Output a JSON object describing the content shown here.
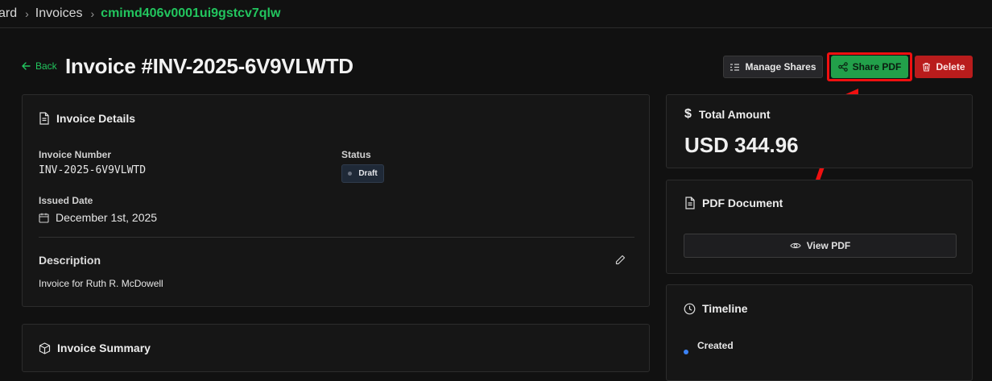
{
  "breadcrumb": {
    "items": [
      "ard",
      "Invoices"
    ],
    "current": "cmimd406v0001ui9gstcv7qlw"
  },
  "header": {
    "back_label": "Back",
    "title": "Invoice #INV-2025-6V9VLWTD",
    "manage_shares_label": "Manage Shares",
    "share_pdf_label": "Share PDF",
    "delete_label": "Delete"
  },
  "invoice_details": {
    "heading": "Invoice Details",
    "number_label": "Invoice Number",
    "number_value": "INV-2025-6V9VLWTD",
    "status_label": "Status",
    "status_value": "Draft",
    "issued_label": "Issued Date",
    "issued_value": "December 1st, 2025",
    "description_label": "Description",
    "description_value": "Invoice for Ruth R. McDowell"
  },
  "invoice_summary": {
    "heading": "Invoice Summary"
  },
  "total_amount": {
    "heading": "Total Amount",
    "value": "USD 344.96"
  },
  "pdf_document": {
    "heading": "PDF Document",
    "view_label": "View PDF"
  },
  "timeline": {
    "heading": "Timeline",
    "events": [
      {
        "label": "Created"
      }
    ]
  },
  "colors": {
    "accent": "#22c55e",
    "share_button": "#22a04a",
    "delete_button": "#b91c1c",
    "highlight": "#ef1010",
    "timeline_dot": "#3b82f6"
  }
}
